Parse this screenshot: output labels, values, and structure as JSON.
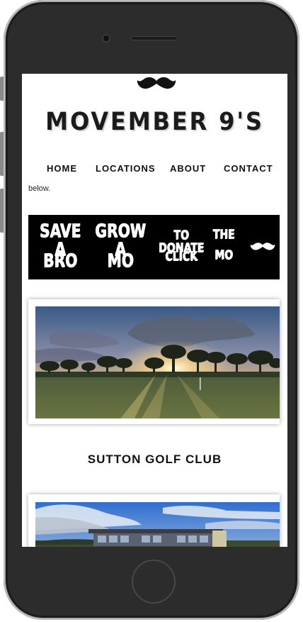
{
  "site": {
    "title": "MOVEMBER 9'S",
    "logo_icon": "mustache-icon"
  },
  "nav": {
    "items": [
      {
        "label": "HOME"
      },
      {
        "label": "LOCATIONS"
      },
      {
        "label": "ABOUT"
      },
      {
        "label": "CONTACT"
      }
    ]
  },
  "intro": {
    "clipped_text": "below."
  },
  "banner": {
    "words": [
      {
        "line1": "SAVE A",
        "line2": "BRO"
      },
      {
        "line1": "GROW A",
        "line2": "MO"
      },
      {
        "line1": "TO DONATE",
        "line2": "CLICK"
      },
      {
        "line1": "THE",
        "line2": "MO"
      }
    ],
    "icon": "mustache-icon"
  },
  "locations": [
    {
      "name": "SUTTON GOLF CLUB",
      "image": "golf-course-sunset-photo"
    },
    {
      "name": "",
      "image": "clubhouse-photo"
    }
  ],
  "colors": {
    "phone_body": "#2c2c2c",
    "banner_bg": "#000000",
    "text": "#111111"
  }
}
